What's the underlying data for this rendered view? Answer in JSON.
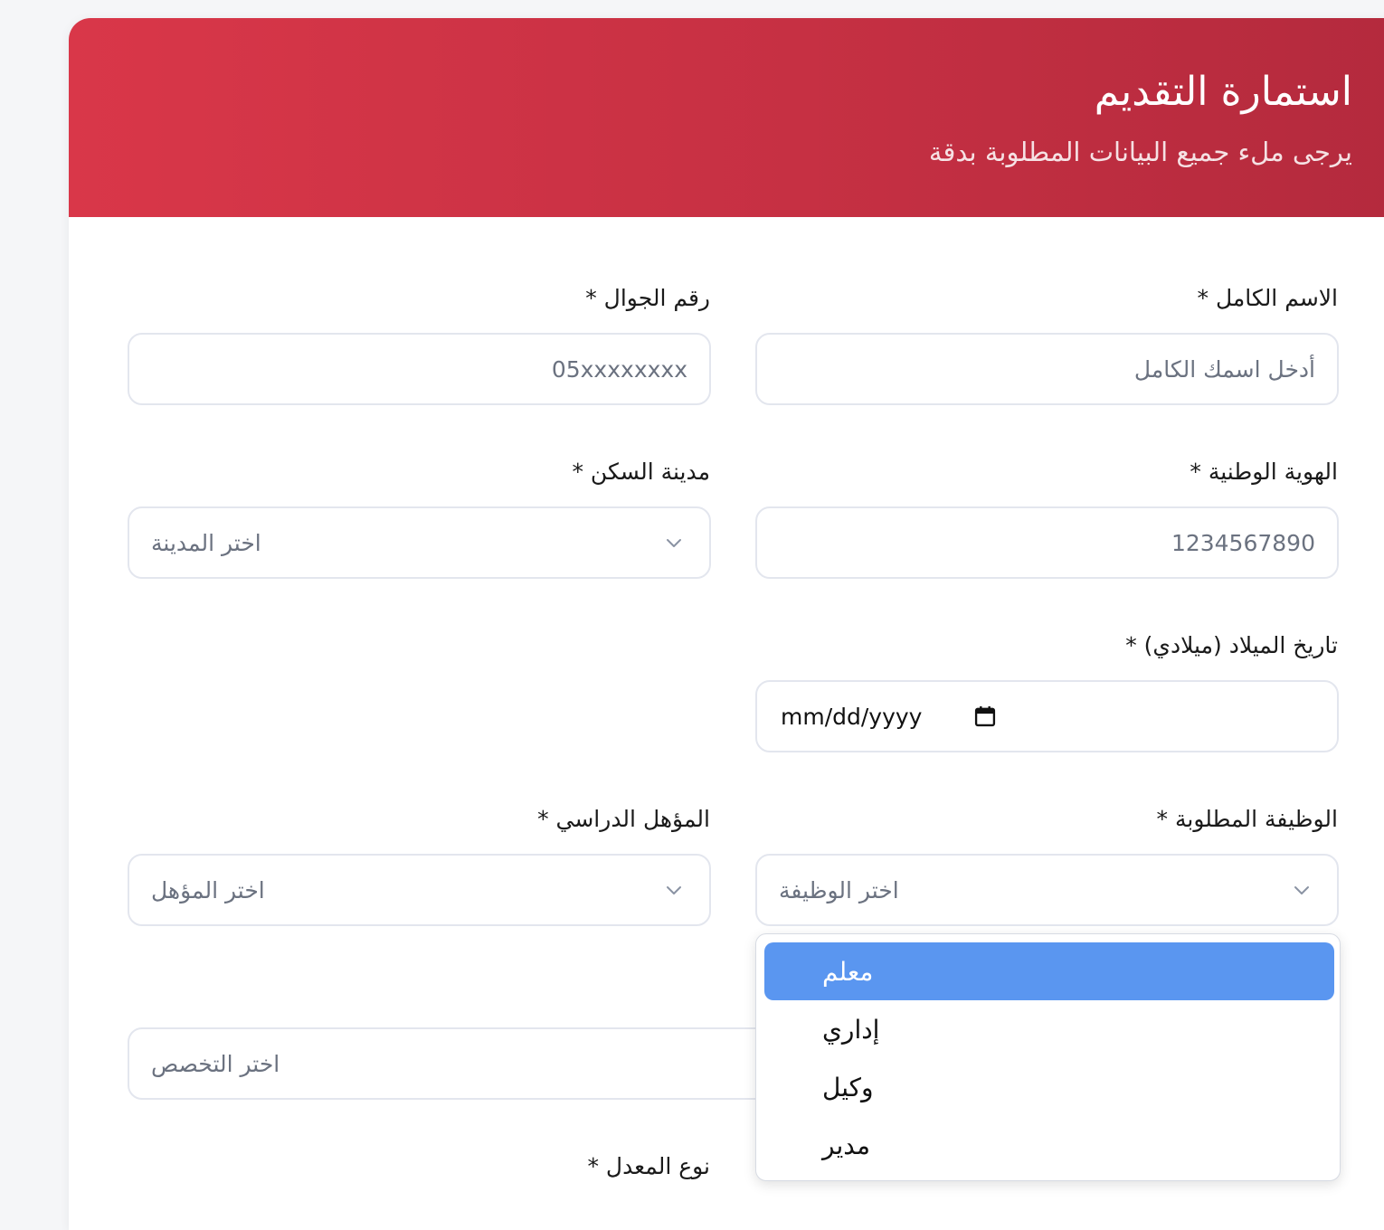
{
  "header": {
    "title": "استمارة التقديم",
    "subtitle": "يرجى ملء جميع البيانات المطلوبة بدقة"
  },
  "fields": {
    "full_name": {
      "label": "الاسم الكامل *",
      "placeholder": "أدخل اسمك الكامل"
    },
    "mobile": {
      "label": "رقم الجوال *",
      "placeholder": "05xxxxxxxx"
    },
    "national_id": {
      "label": "الهوية الوطنية *",
      "placeholder": "1234567890"
    },
    "city": {
      "label": "مدينة السكن *",
      "placeholder": "اختر المدينة",
      "icon": "chevron-down-icon"
    },
    "birth_date": {
      "label": "تاريخ الميلاد (ميلادي) *",
      "value": "mm/dd/yyyy",
      "icon": "calendar-icon"
    },
    "job": {
      "label": "الوظيفة المطلوبة *",
      "placeholder": "اختر الوظيفة",
      "icon": "chevron-down-icon"
    },
    "qualification": {
      "label": "المؤهل الدراسي *",
      "placeholder": "اختر المؤهل",
      "icon": "chevron-down-icon"
    },
    "specialization": {
      "placeholder": "اختر التخصص"
    },
    "grade_type": {
      "label": "نوع المعدل *"
    }
  },
  "job_dropdown": {
    "options": [
      "معلم",
      "إداري",
      "وكيل",
      "مدير"
    ],
    "highlighted_index": 0,
    "highlight_color": "#5a96f0"
  },
  "colors": {
    "header_gradient_start": "#d93749",
    "header_gradient_end": "#b42a3d",
    "field_border": "#e3e6ee",
    "placeholder_text": "#6b7280"
  }
}
